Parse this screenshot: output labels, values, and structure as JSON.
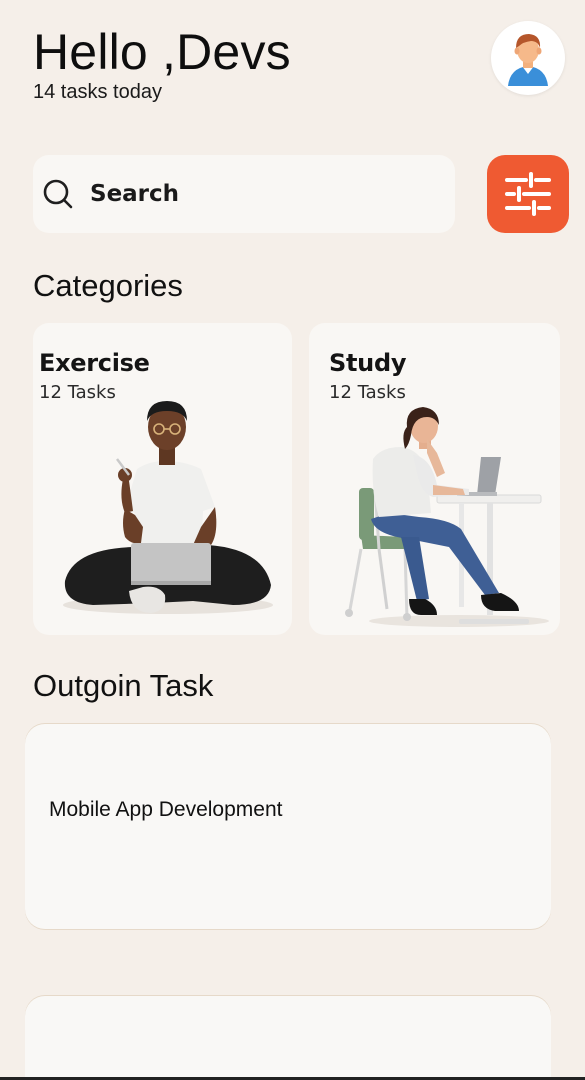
{
  "header": {
    "greeting": "Hello ,Devs",
    "subtitle": "14 tasks today",
    "avatar_icon": "user-avatar-icon"
  },
  "search": {
    "label": "Search",
    "icon": "search-icon"
  },
  "filter": {
    "icon": "sliders-icon",
    "color": "#ef5a32"
  },
  "categories": {
    "title": "Categories",
    "items": [
      {
        "name": "Exercise",
        "count": "12 Tasks",
        "illustration": "person-sitting-with-laptop"
      },
      {
        "name": "Study",
        "count": "12 Tasks",
        "illustration": "person-at-desk-with-laptop"
      }
    ]
  },
  "outgoing": {
    "title": "Outgoin Task",
    "tasks": [
      {
        "name": "Mobile App Development"
      },
      {
        "name": ""
      }
    ]
  },
  "colors": {
    "background": "#f5efe9",
    "card": "#f9f7f4",
    "accent": "#ef5a32"
  }
}
